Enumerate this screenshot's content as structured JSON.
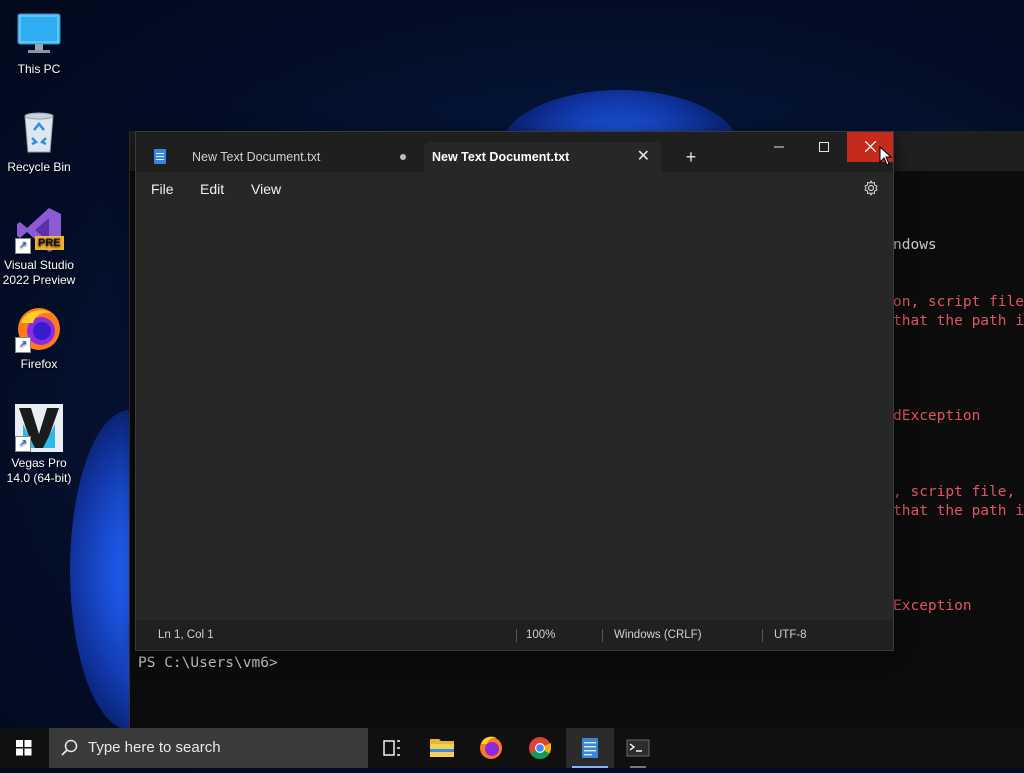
{
  "desktop": {
    "icons": [
      {
        "label_1": "This PC",
        "label_2": "",
        "icon": "monitor-icon"
      },
      {
        "label_1": "Recycle Bin",
        "label_2": "",
        "icon": "recycle-bin-icon"
      },
      {
        "label_1": "Visual Studio",
        "label_2": "2022 Preview",
        "icon": "visual-studio-icon",
        "badge": "PRE"
      },
      {
        "label_1": "Firefox",
        "label_2": "",
        "icon": "firefox-icon"
      },
      {
        "label_1": "Vegas Pro",
        "label_2": "14.0 (64-bit)",
        "icon": "vegas-pro-icon"
      }
    ]
  },
  "terminal": {
    "lines": [
      {
        "text": "ndows",
        "color": "gray"
      },
      {
        "text": "on, script file",
        "color": "red"
      },
      {
        "text": "that the path i",
        "color": "red"
      },
      {
        "text": "dException",
        "color": "red"
      },
      {
        "text": ", script file, ",
        "color": "red"
      },
      {
        "text": "that the path i",
        "color": "red"
      },
      {
        "text": "Exception",
        "color": "red"
      }
    ],
    "prompt": "PS C:\\Users\\vm6>"
  },
  "notepad": {
    "tabs": [
      {
        "title": "New Text Document.txt",
        "unsaved": true,
        "active": false
      },
      {
        "title": "New Text Document.txt",
        "unsaved": false,
        "active": true
      }
    ],
    "add_tab": "+",
    "window_buttons": {
      "minimize": "—",
      "maximize": "☐",
      "close": "✕"
    },
    "menu": {
      "file": "File",
      "edit": "Edit",
      "view": "View"
    },
    "editor_text": "",
    "status": {
      "position": "Ln 1, Col 1",
      "zoom": "100%",
      "line_ending": "Windows (CRLF)",
      "encoding": "UTF-8"
    }
  },
  "taskbar": {
    "search_placeholder": "Type here to search",
    "apps": [
      "task-view-icon",
      "file-explorer-icon",
      "firefox-icon",
      "chrome-icon",
      "notepad-icon",
      "terminal-icon"
    ],
    "active_app": "notepad-icon"
  },
  "colors": {
    "close_button": "#c42b1c",
    "terminal_error": "#e05561",
    "taskbar_active_indicator": "#8ab4f8"
  }
}
